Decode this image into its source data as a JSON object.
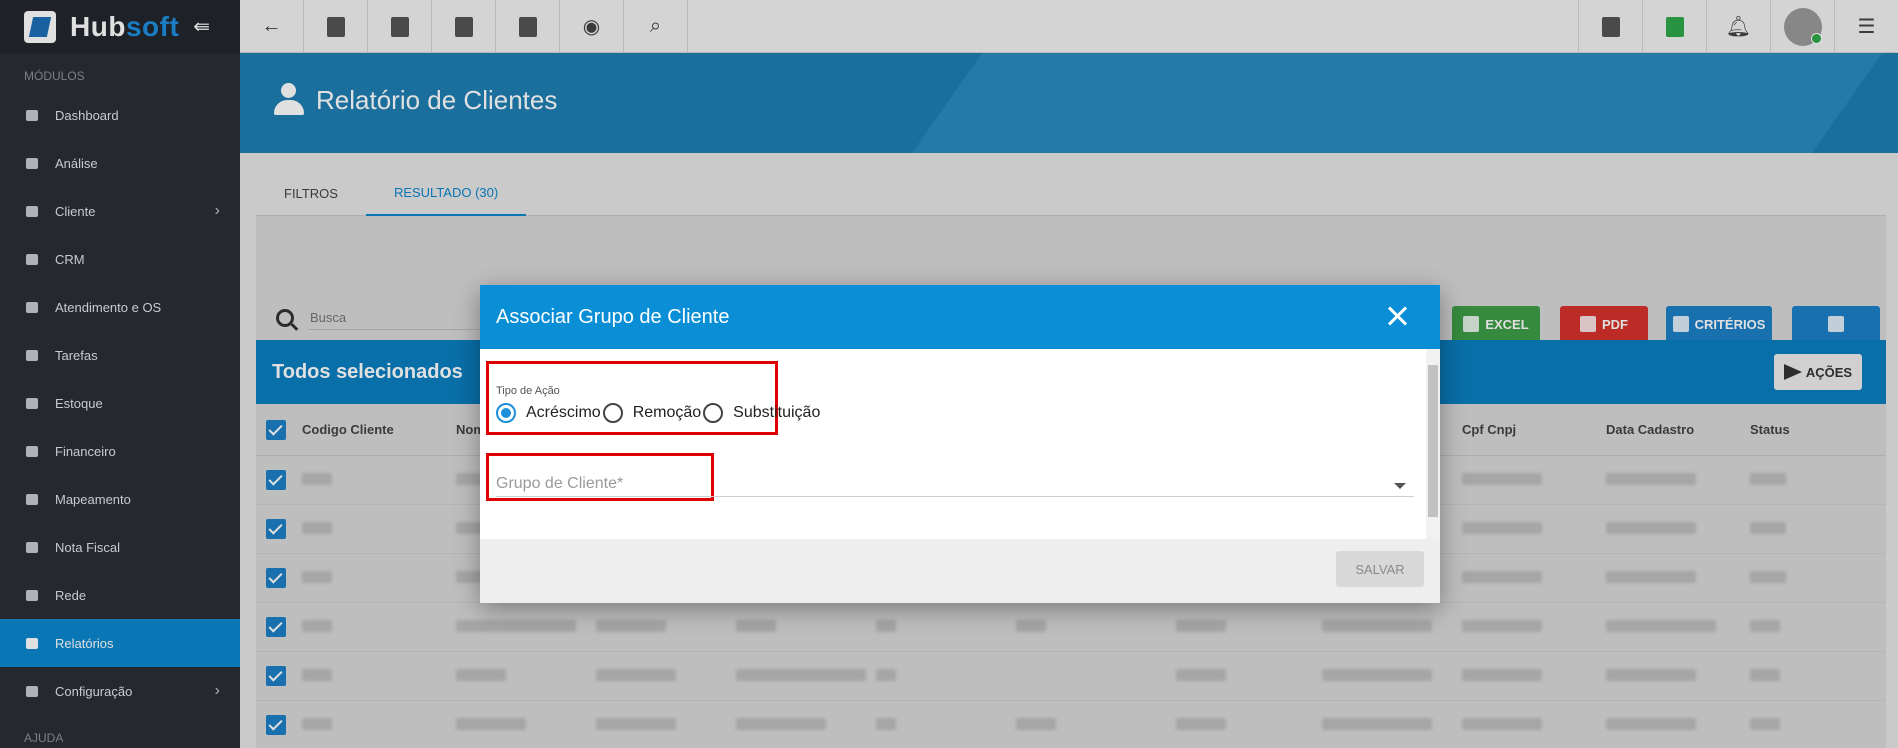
{
  "brand": {
    "hub": "Hub",
    "soft": "soft"
  },
  "sidebar": {
    "section_modulos": "MÓDULOS",
    "section_ajuda": "AJUDA",
    "items": [
      {
        "label": "Dashboard",
        "icon": "dashboard-icon",
        "has_children": false,
        "active": false
      },
      {
        "label": "Análise",
        "icon": "pie-chart-icon",
        "has_children": false,
        "active": false
      },
      {
        "label": "Cliente",
        "icon": "contact-card-icon",
        "has_children": true,
        "active": false
      },
      {
        "label": "CRM",
        "icon": "kanban-icon",
        "has_children": false,
        "active": false
      },
      {
        "label": "Atendimento e OS",
        "icon": "calendar-clock-icon",
        "has_children": false,
        "active": false
      },
      {
        "label": "Tarefas",
        "icon": "tasks-icon",
        "has_children": false,
        "active": false
      },
      {
        "label": "Estoque",
        "icon": "box-icon",
        "has_children": false,
        "active": false
      },
      {
        "label": "Financeiro",
        "icon": "money-icon",
        "has_children": false,
        "active": false
      },
      {
        "label": "Mapeamento",
        "icon": "map-pin-icon",
        "has_children": false,
        "active": false
      },
      {
        "label": "Nota Fiscal",
        "icon": "receipt-icon",
        "has_children": false,
        "active": false
      },
      {
        "label": "Rede",
        "icon": "network-icon",
        "has_children": false,
        "active": false
      },
      {
        "label": "Relatórios",
        "icon": "report-icon",
        "has_children": false,
        "active": true
      },
      {
        "label": "Configuração",
        "icon": "gear-icon",
        "has_children": true,
        "active": false
      }
    ]
  },
  "topbar": {
    "left_icons": [
      "back-arrow-icon",
      "contact-icon",
      "calendar-clock-icon",
      "dollar-icon",
      "terminal-icon",
      "eye-icon",
      "search-icon"
    ],
    "right_icons": [
      "pdf-icon",
      "check-message-icon",
      "bell-icon",
      "avatar",
      "list-icon"
    ]
  },
  "page": {
    "title": "Relatório de Clientes"
  },
  "tabs": [
    {
      "label": "FILTROS",
      "active": false
    },
    {
      "label": "RESULTADO (30)",
      "active": true
    }
  ],
  "toolbar": {
    "search_placeholder": "Busca",
    "excel_label": "EXCEL",
    "pdf_label": "PDF",
    "criterios_label": "CRITÉRIOS"
  },
  "selection_bar": {
    "title": "Todos selecionados",
    "acoes_label": "AÇÕES"
  },
  "table": {
    "headers": [
      "Codigo Cliente",
      "Nom",
      "Cpf Cnpj",
      "Data Cadastro",
      "Status"
    ],
    "row_count_visible": 6
  },
  "modal": {
    "title": "Associar Grupo de Cliente",
    "tipo_acao_label": "Tipo de Ação",
    "options": [
      "Acréscimo",
      "Remoção",
      "Substituição"
    ],
    "selected_option": "Acréscimo",
    "grupo_placeholder": "Grupo de Cliente*",
    "save_label": "SALVAR"
  },
  "colors": {
    "accent": "#0b87cf",
    "modal_header": "#0a8fd6",
    "highlight_box": "#e00000",
    "excel": "#3d9e46",
    "pdf": "#d6322c"
  }
}
